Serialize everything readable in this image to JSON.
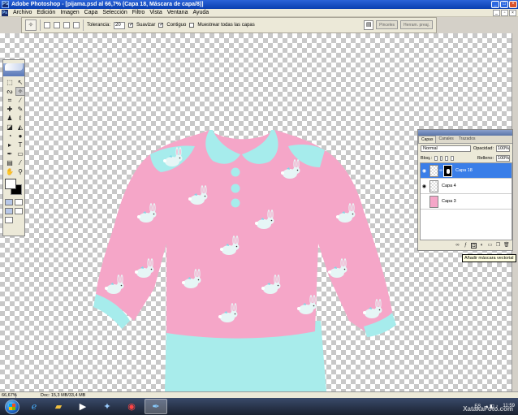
{
  "window": {
    "title": "Adobe Photoshop - [pijama.psd al 66,7% (Capa 18, Máscara de capa/8)]",
    "app_icon": "Ps"
  },
  "menu": [
    "Archivo",
    "Edición",
    "Imagen",
    "Capa",
    "Selección",
    "Filtro",
    "Vista",
    "Ventana",
    "Ayuda"
  ],
  "options": {
    "tolerance_label": "Tolerancia:",
    "tolerance_value": "20",
    "antialias_label": "Suavizar",
    "contiguous_label": "Contiguo",
    "all_layers_label": "Muestrear todas las capas",
    "palette_tabs": [
      "Pinceles",
      "Herram. preaj."
    ]
  },
  "layers_panel": {
    "tabs": [
      "Capas",
      "Canales",
      "Trazados"
    ],
    "blend_mode": "Normal",
    "opacity_label": "Opacidad:",
    "opacity_value": "100%",
    "lock_label": "Bloq.:",
    "fill_label": "Relleno:",
    "fill_value": "100%",
    "layers": [
      {
        "name": "Capa 18",
        "selected": true,
        "visible": true,
        "has_mask": true
      },
      {
        "name": "Capa 4",
        "selected": false,
        "visible": true,
        "has_mask": false
      },
      {
        "name": "Capa 3",
        "selected": false,
        "visible": false,
        "has_mask": false
      }
    ],
    "tooltip": "Añadir máscara vectorial"
  },
  "status": {
    "zoom": "66,67%",
    "doc": "Doc: 15,3 MB/33,4 MB"
  },
  "taskbar": {
    "language": "ES",
    "time": "11:59",
    "date": ""
  },
  "watermark": "XatakaFoto.com",
  "colors": {
    "pajama_pink": "#f5a6c8",
    "collar_cyan": "#a6ecec",
    "pants_cyan": "#a8eceb",
    "selection_blue": "#3a7ee8"
  }
}
